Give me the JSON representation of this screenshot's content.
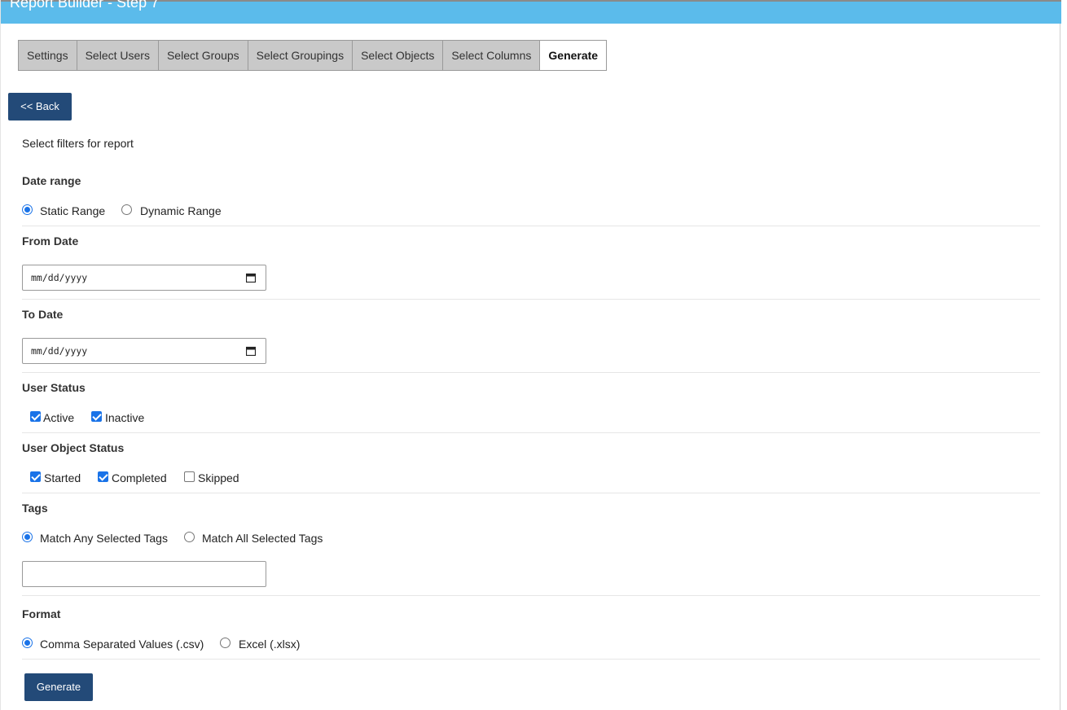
{
  "header": {
    "title": "Report Builder - Step 7"
  },
  "tabs": [
    {
      "label": "Settings"
    },
    {
      "label": "Select Users"
    },
    {
      "label": "Select Groups"
    },
    {
      "label": "Select Groupings"
    },
    {
      "label": "Select Objects"
    },
    {
      "label": "Select Columns"
    },
    {
      "label": "Generate"
    }
  ],
  "back_button": "<< Back",
  "intro": "Select filters for report",
  "date_range": {
    "label": "Date range",
    "options": [
      {
        "label": "Static Range",
        "selected": true
      },
      {
        "label": "Dynamic Range",
        "selected": false
      }
    ]
  },
  "from_date": {
    "label": "From Date",
    "placeholder": "mm/dd/yyyy"
  },
  "to_date": {
    "label": "To Date",
    "placeholder": "mm/dd/yyyy"
  },
  "user_status": {
    "label": "User Status",
    "options": [
      {
        "label": "Active",
        "checked": true
      },
      {
        "label": "Inactive",
        "checked": true
      }
    ]
  },
  "user_object_status": {
    "label": "User Object Status",
    "options": [
      {
        "label": "Started",
        "checked": true
      },
      {
        "label": "Completed",
        "checked": true
      },
      {
        "label": "Skipped",
        "checked": false
      }
    ]
  },
  "tags": {
    "label": "Tags",
    "options": [
      {
        "label": "Match Any Selected Tags",
        "selected": true
      },
      {
        "label": "Match All Selected Tags",
        "selected": false
      }
    ],
    "value": ""
  },
  "format": {
    "label": "Format",
    "options": [
      {
        "label": "Comma Separated Values (.csv)",
        "selected": true
      },
      {
        "label": "Excel (.xlsx)",
        "selected": false
      }
    ]
  },
  "generate_button": "Generate",
  "colors": {
    "header": "#5bbbeb",
    "button": "#234a78",
    "accent": "#1a73e8"
  },
  "icons": {
    "date_picker": "calendar-icon"
  }
}
